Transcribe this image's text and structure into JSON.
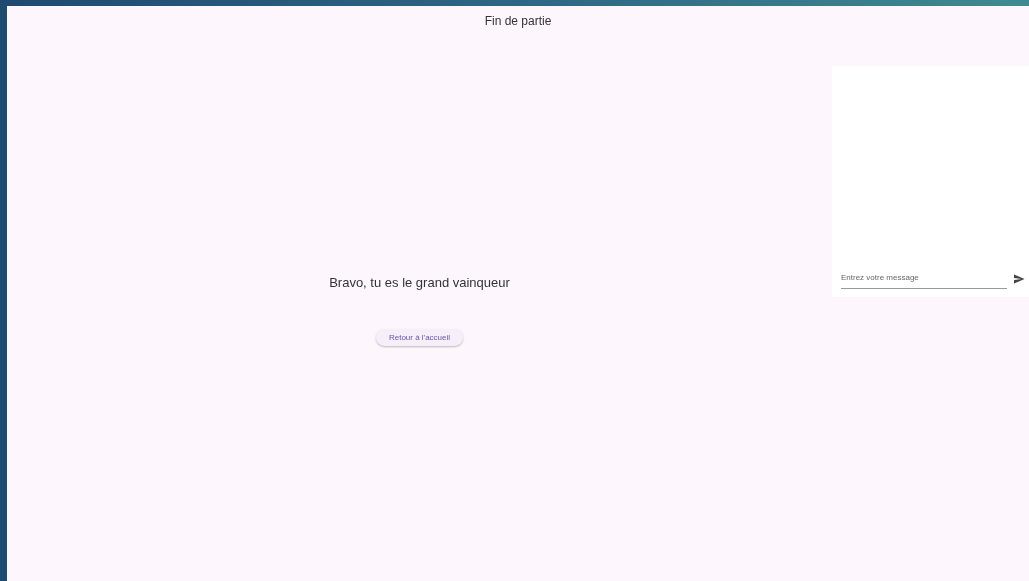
{
  "header": {
    "title": "Fin de partie"
  },
  "result": {
    "message": "Bravo, tu es le grand vainqueur"
  },
  "buttons": [
    {
      "label": "Retour à l'accueil"
    }
  ],
  "chat": {
    "input": {
      "placeholder": "Entrez votre message"
    }
  }
}
